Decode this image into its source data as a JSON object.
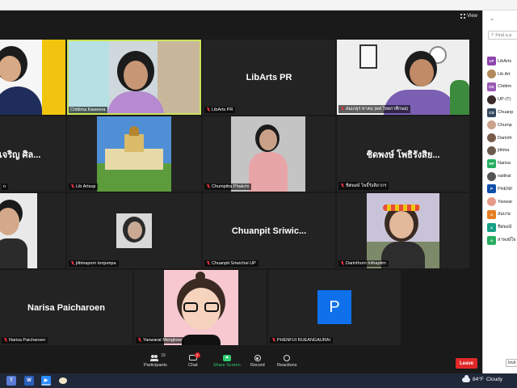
{
  "meeting": {
    "view_label": "View",
    "tiles": [
      {
        "id": "t1",
        "label": "",
        "big_name": ""
      },
      {
        "id": "t2",
        "label": "Chittima Kaweera",
        "big_name": ""
      },
      {
        "id": "t3",
        "label": "LibArts PR",
        "big_name": "LibArts PR"
      },
      {
        "id": "t4",
        "label": "สมเกยุร ทาคม (ผศ.ไทยกาศึกษอ)",
        "big_name": ""
      },
      {
        "id": "t5",
        "label": "n",
        "big_name": "เจริญ ศิล..."
      },
      {
        "id": "t6",
        "label": "Lib Artsup",
        "big_name": ""
      },
      {
        "id": "t7",
        "label": "Chumpitra Phakchi",
        "big_name": ""
      },
      {
        "id": "t8",
        "label": "ชิตพงษ์ โพธิ์รังสิยากร",
        "big_name": "ชิดพงษ์ โพธิรังสิย..."
      },
      {
        "id": "t9",
        "label": "",
        "big_name": ""
      },
      {
        "id": "t10",
        "label": "jittimaporn tonjumpa",
        "big_name": ""
      },
      {
        "id": "t11",
        "label": "Chuanpit Sriwichai UP",
        "big_name": "Chuanpit Sriwic..."
      },
      {
        "id": "t12",
        "label": "Darinthorn Inthaptim",
        "big_name": ""
      },
      {
        "id": "t13",
        "label": "Narisa Paicharoen",
        "big_name": "Narisa Paicharoen"
      },
      {
        "id": "t14",
        "label": "Yaowarat Mengkow",
        "big_name": ""
      },
      {
        "id": "t15",
        "label": "PHENFUI RUEANGAURAI",
        "big_name": ""
      }
    ],
    "avatar_letter": "P"
  },
  "toolbar": {
    "participants_label": "Participants",
    "participants_count": "15",
    "chat_label": "Chat",
    "chat_badge": "2",
    "share_label": "Share Screen",
    "record_label": "Record",
    "reactions_label": "Reactions",
    "leave_label": "Leave"
  },
  "panel": {
    "search_placeholder": "Find a p",
    "participants": [
      {
        "initials": "LP",
        "name": "LibArts",
        "color": "#8e44ad"
      },
      {
        "initials": "",
        "name": "Lib Art",
        "color": "#b08a5a"
      },
      {
        "initials": "CK",
        "name": "Chittim",
        "color": "#9b59b6"
      },
      {
        "initials": "",
        "name": "UP-(T)",
        "color": "#3b2b2b"
      },
      {
        "initials": "CS",
        "name": "Chuanp",
        "color": "#34495e"
      },
      {
        "initials": "",
        "name": "Chump",
        "color": "#c9a28a"
      },
      {
        "initials": "",
        "name": "Darinth",
        "color": "#7a5c4a"
      },
      {
        "initials": "",
        "name": "jittima",
        "color": "#6b5a4e"
      },
      {
        "initials": "NP",
        "name": "Narisa",
        "color": "#27ae60"
      },
      {
        "initials": "",
        "name": "natthal",
        "color": "#555555"
      },
      {
        "initials": "P",
        "name": "PHENF",
        "color": "#0e4fa8"
      },
      {
        "initials": "",
        "name": "Yaowar",
        "color": "#e59a8a"
      },
      {
        "initials": "a",
        "name": "สมเกษ",
        "color": "#e67e22"
      },
      {
        "initials": "a",
        "name": "ชิดพงษ์",
        "color": "#16a085"
      },
      {
        "initials": "a",
        "name": "สาพงษ์ใจ",
        "color": "#27ae60"
      }
    ],
    "invite_label": "Invit"
  },
  "taskbar": {
    "weather_temp": "84°F",
    "weather_text": "Cloudy"
  }
}
